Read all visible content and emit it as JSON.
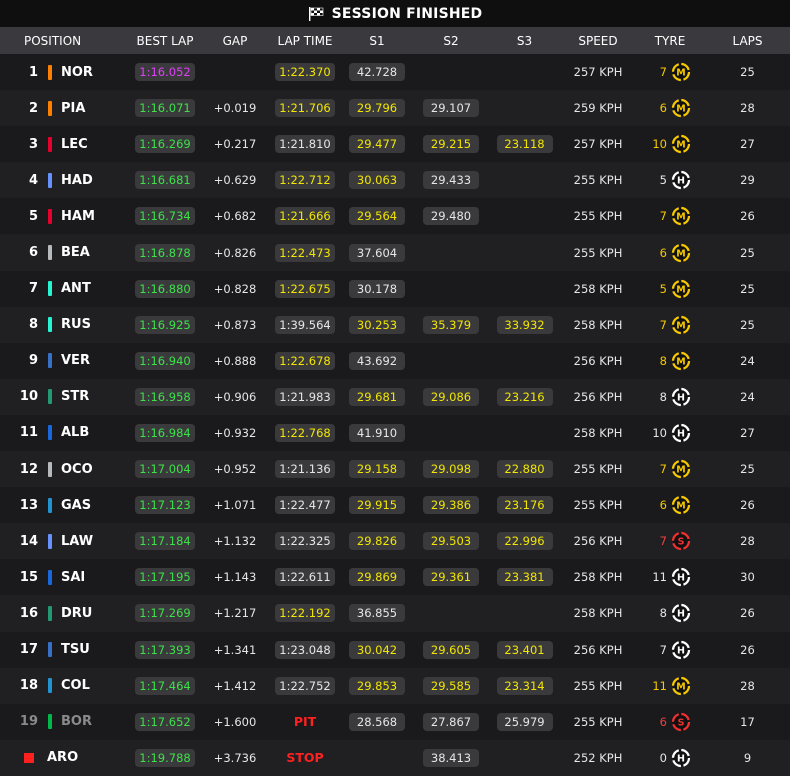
{
  "header": {
    "title": "SESSION FINISHED"
  },
  "columns": {
    "position": "POSITION",
    "best_lap": "BEST LAP",
    "gap": "GAP",
    "lap_time": "LAP TIME",
    "s1": "S1",
    "s2": "S2",
    "s3": "S3",
    "speed": "SPEED",
    "tyre": "TYRE",
    "laps": "LAPS"
  },
  "colors": {
    "purple": "#e040fb",
    "green": "#3ce14a",
    "yellow": "#f2e600",
    "tyre_medium": "#f5c800",
    "tyre_hard": "#ffffff",
    "tyre_soft": "#f03030",
    "stop": "#ff2020"
  },
  "rows": [
    {
      "pos": "1",
      "code": "NOR",
      "team": "#ff8000",
      "best": "1:16.052",
      "best_c": "purple",
      "gap": "",
      "lap": "1:22.370",
      "lap_c": "yellow",
      "s1": "42.728",
      "s1_c": "white",
      "s2": "",
      "s2_c": "",
      "s3": "",
      "s3_c": "",
      "speed": "257 KPH",
      "tyre_age": "7",
      "tyre": "M",
      "laps": "25"
    },
    {
      "pos": "2",
      "code": "PIA",
      "team": "#ff8000",
      "best": "1:16.071",
      "best_c": "green",
      "gap": "+0.019",
      "lap": "1:21.706",
      "lap_c": "yellow",
      "s1": "29.796",
      "s1_c": "yellow",
      "s2": "29.107",
      "s2_c": "white",
      "s3": "",
      "s3_c": "",
      "speed": "259 KPH",
      "tyre_age": "6",
      "tyre": "M",
      "laps": "28"
    },
    {
      "pos": "3",
      "code": "LEC",
      "team": "#e8002d",
      "best": "1:16.269",
      "best_c": "green",
      "gap": "+0.217",
      "lap": "1:21.810",
      "lap_c": "",
      "s1": "29.477",
      "s1_c": "yellow",
      "s2": "29.215",
      "s2_c": "yellow",
      "s3": "23.118",
      "s3_c": "yellow",
      "speed": "257 KPH",
      "tyre_age": "10",
      "tyre": "M",
      "laps": "27"
    },
    {
      "pos": "4",
      "code": "HAD",
      "team": "#6692ff",
      "best": "1:16.681",
      "best_c": "green",
      "gap": "+0.629",
      "lap": "1:22.712",
      "lap_c": "yellow",
      "s1": "30.063",
      "s1_c": "yellow",
      "s2": "29.433",
      "s2_c": "white",
      "s3": "",
      "s3_c": "",
      "speed": "255 KPH",
      "tyre_age": "5",
      "tyre": "H",
      "laps": "29"
    },
    {
      "pos": "5",
      "code": "HAM",
      "team": "#e8002d",
      "best": "1:16.734",
      "best_c": "green",
      "gap": "+0.682",
      "lap": "1:21.666",
      "lap_c": "yellow",
      "s1": "29.564",
      "s1_c": "yellow",
      "s2": "29.480",
      "s2_c": "white",
      "s3": "",
      "s3_c": "",
      "speed": "255 KPH",
      "tyre_age": "7",
      "tyre": "M",
      "laps": "26"
    },
    {
      "pos": "6",
      "code": "BEA",
      "team": "#b6babd",
      "best": "1:16.878",
      "best_c": "green",
      "gap": "+0.826",
      "lap": "1:22.473",
      "lap_c": "yellow",
      "s1": "37.604",
      "s1_c": "white",
      "s2": "",
      "s2_c": "",
      "s3": "",
      "s3_c": "",
      "speed": "255 KPH",
      "tyre_age": "6",
      "tyre": "M",
      "laps": "25"
    },
    {
      "pos": "7",
      "code": "ANT",
      "team": "#27f4d2",
      "best": "1:16.880",
      "best_c": "green",
      "gap": "+0.828",
      "lap": "1:22.675",
      "lap_c": "yellow",
      "s1": "30.178",
      "s1_c": "white",
      "s2": "",
      "s2_c": "",
      "s3": "",
      "s3_c": "",
      "speed": "258 KPH",
      "tyre_age": "5",
      "tyre": "M",
      "laps": "25"
    },
    {
      "pos": "8",
      "code": "RUS",
      "team": "#27f4d2",
      "best": "1:16.925",
      "best_c": "green",
      "gap": "+0.873",
      "lap": "1:39.564",
      "lap_c": "",
      "s1": "30.253",
      "s1_c": "yellow",
      "s2": "35.379",
      "s2_c": "yellow",
      "s3": "33.932",
      "s3_c": "yellow",
      "speed": "258 KPH",
      "tyre_age": "7",
      "tyre": "M",
      "laps": "25"
    },
    {
      "pos": "9",
      "code": "VER",
      "team": "#3671c6",
      "best": "1:16.940",
      "best_c": "green",
      "gap": "+0.888",
      "lap": "1:22.678",
      "lap_c": "yellow",
      "s1": "43.692",
      "s1_c": "white",
      "s2": "",
      "s2_c": "",
      "s3": "",
      "s3_c": "",
      "speed": "256 KPH",
      "tyre_age": "8",
      "tyre": "M",
      "laps": "24"
    },
    {
      "pos": "10",
      "code": "STR",
      "team": "#229971",
      "best": "1:16.958",
      "best_c": "green",
      "gap": "+0.906",
      "lap": "1:21.983",
      "lap_c": "",
      "s1": "29.681",
      "s1_c": "yellow",
      "s2": "29.086",
      "s2_c": "yellow",
      "s3": "23.216",
      "s3_c": "yellow",
      "speed": "256 KPH",
      "tyre_age": "8",
      "tyre": "H",
      "laps": "24"
    },
    {
      "pos": "11",
      "code": "ALB",
      "team": "#1868db",
      "best": "1:16.984",
      "best_c": "green",
      "gap": "+0.932",
      "lap": "1:22.768",
      "lap_c": "yellow",
      "s1": "41.910",
      "s1_c": "white",
      "s2": "",
      "s2_c": "",
      "s3": "",
      "s3_c": "",
      "speed": "258 KPH",
      "tyre_age": "10",
      "tyre": "H",
      "laps": "27"
    },
    {
      "pos": "12",
      "code": "OCO",
      "team": "#b6babd",
      "best": "1:17.004",
      "best_c": "green",
      "gap": "+0.952",
      "lap": "1:21.136",
      "lap_c": "",
      "s1": "29.158",
      "s1_c": "yellow",
      "s2": "29.098",
      "s2_c": "yellow",
      "s3": "22.880",
      "s3_c": "yellow",
      "speed": "255 KPH",
      "tyre_age": "7",
      "tyre": "M",
      "laps": "25"
    },
    {
      "pos": "13",
      "code": "GAS",
      "team": "#2293d1",
      "best": "1:17.123",
      "best_c": "green",
      "gap": "+1.071",
      "lap": "1:22.477",
      "lap_c": "",
      "s1": "29.915",
      "s1_c": "yellow",
      "s2": "29.386",
      "s2_c": "yellow",
      "s3": "23.176",
      "s3_c": "yellow",
      "speed": "255 KPH",
      "tyre_age": "6",
      "tyre": "M",
      "laps": "26"
    },
    {
      "pos": "14",
      "code": "LAW",
      "team": "#6692ff",
      "best": "1:17.184",
      "best_c": "green",
      "gap": "+1.132",
      "lap": "1:22.325",
      "lap_c": "",
      "s1": "29.826",
      "s1_c": "yellow",
      "s2": "29.503",
      "s2_c": "yellow",
      "s3": "22.996",
      "s3_c": "yellow",
      "speed": "256 KPH",
      "tyre_age": "7",
      "tyre": "S",
      "laps": "28"
    },
    {
      "pos": "15",
      "code": "SAI",
      "team": "#1868db",
      "best": "1:17.195",
      "best_c": "green",
      "gap": "+1.143",
      "lap": "1:22.611",
      "lap_c": "",
      "s1": "29.869",
      "s1_c": "yellow",
      "s2": "29.361",
      "s2_c": "yellow",
      "s3": "23.381",
      "s3_c": "yellow",
      "speed": "258 KPH",
      "tyre_age": "11",
      "tyre": "H",
      "laps": "30"
    },
    {
      "pos": "16",
      "code": "DRU",
      "team": "#229971",
      "best": "1:17.269",
      "best_c": "green",
      "gap": "+1.217",
      "lap": "1:22.192",
      "lap_c": "yellow",
      "s1": "36.855",
      "s1_c": "white",
      "s2": "",
      "s2_c": "",
      "s3": "",
      "s3_c": "",
      "speed": "258 KPH",
      "tyre_age": "8",
      "tyre": "H",
      "laps": "26"
    },
    {
      "pos": "17",
      "code": "TSU",
      "team": "#3671c6",
      "best": "1:17.393",
      "best_c": "green",
      "gap": "+1.341",
      "lap": "1:23.048",
      "lap_c": "",
      "s1": "30.042",
      "s1_c": "yellow",
      "s2": "29.605",
      "s2_c": "yellow",
      "s3": "23.401",
      "s3_c": "yellow",
      "speed": "256 KPH",
      "tyre_age": "7",
      "tyre": "H",
      "laps": "26"
    },
    {
      "pos": "18",
      "code": "COL",
      "team": "#2293d1",
      "best": "1:17.464",
      "best_c": "green",
      "gap": "+1.412",
      "lap": "1:22.752",
      "lap_c": "",
      "s1": "29.853",
      "s1_c": "yellow",
      "s2": "29.585",
      "s2_c": "yellow",
      "s3": "23.314",
      "s3_c": "yellow",
      "speed": "255 KPH",
      "tyre_age": "11",
      "tyre": "M",
      "laps": "28"
    },
    {
      "pos": "19",
      "code": "BOR",
      "team": "#00b84a",
      "retired": true,
      "best": "1:17.652",
      "best_c": "green",
      "gap": "+1.600",
      "status": "PIT",
      "s1": "28.568",
      "s1_c": "white",
      "s2": "27.867",
      "s2_c": "white",
      "s3": "25.979",
      "s3_c": "white",
      "speed": "255 KPH",
      "tyre_age": "6",
      "tyre": "S",
      "laps": "17"
    },
    {
      "pos": "",
      "code": "ARO",
      "team": "#00b84a",
      "dnf": true,
      "best": "1:19.788",
      "best_c": "green",
      "gap": "+3.736",
      "status": "STOP",
      "s1": "",
      "s1_c": "",
      "s2": "38.413",
      "s2_c": "white",
      "s3": "",
      "s3_c": "",
      "speed": "252 KPH",
      "tyre_age": "0",
      "tyre": "H",
      "laps": "9"
    }
  ]
}
